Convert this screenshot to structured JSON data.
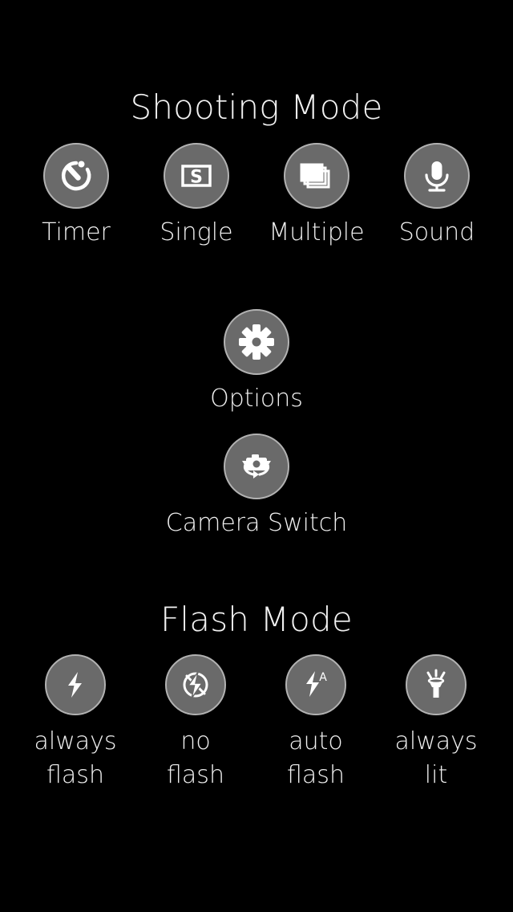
{
  "app": {
    "background_color": "#000000",
    "circle_fill_color": "#6a6a6a",
    "circle_border_color": "#b2b2b2",
    "text_color": "#f0f0f0"
  },
  "shooting_section": {
    "title": "Shooting Mode",
    "items": [
      {
        "label": "Timer",
        "icon": "stopwatch-timer-icon"
      },
      {
        "label": "Single",
        "icon": "single-s-frame-icon"
      },
      {
        "label": "Multiple",
        "icon": "multiple-frames-stack-icon"
      },
      {
        "label": "Sound",
        "icon": "microphone-icon"
      }
    ]
  },
  "options_item": {
    "label": "Options",
    "icon": "gear-icon"
  },
  "camera_switch_item": {
    "label": "Camera Switch",
    "icon": "camera-switch-icon"
  },
  "flash_section": {
    "title": "Flash Mode",
    "items": [
      {
        "label": "always\nflash",
        "icon": "flash-on-bolt-icon"
      },
      {
        "label": "no\nflash",
        "icon": "flash-off-bolt-slash-icon"
      },
      {
        "label": "auto\nflash",
        "icon": "flash-auto-bolt-a-icon"
      },
      {
        "label": "always\nlit",
        "icon": "flashlight-torch-icon"
      }
    ]
  }
}
